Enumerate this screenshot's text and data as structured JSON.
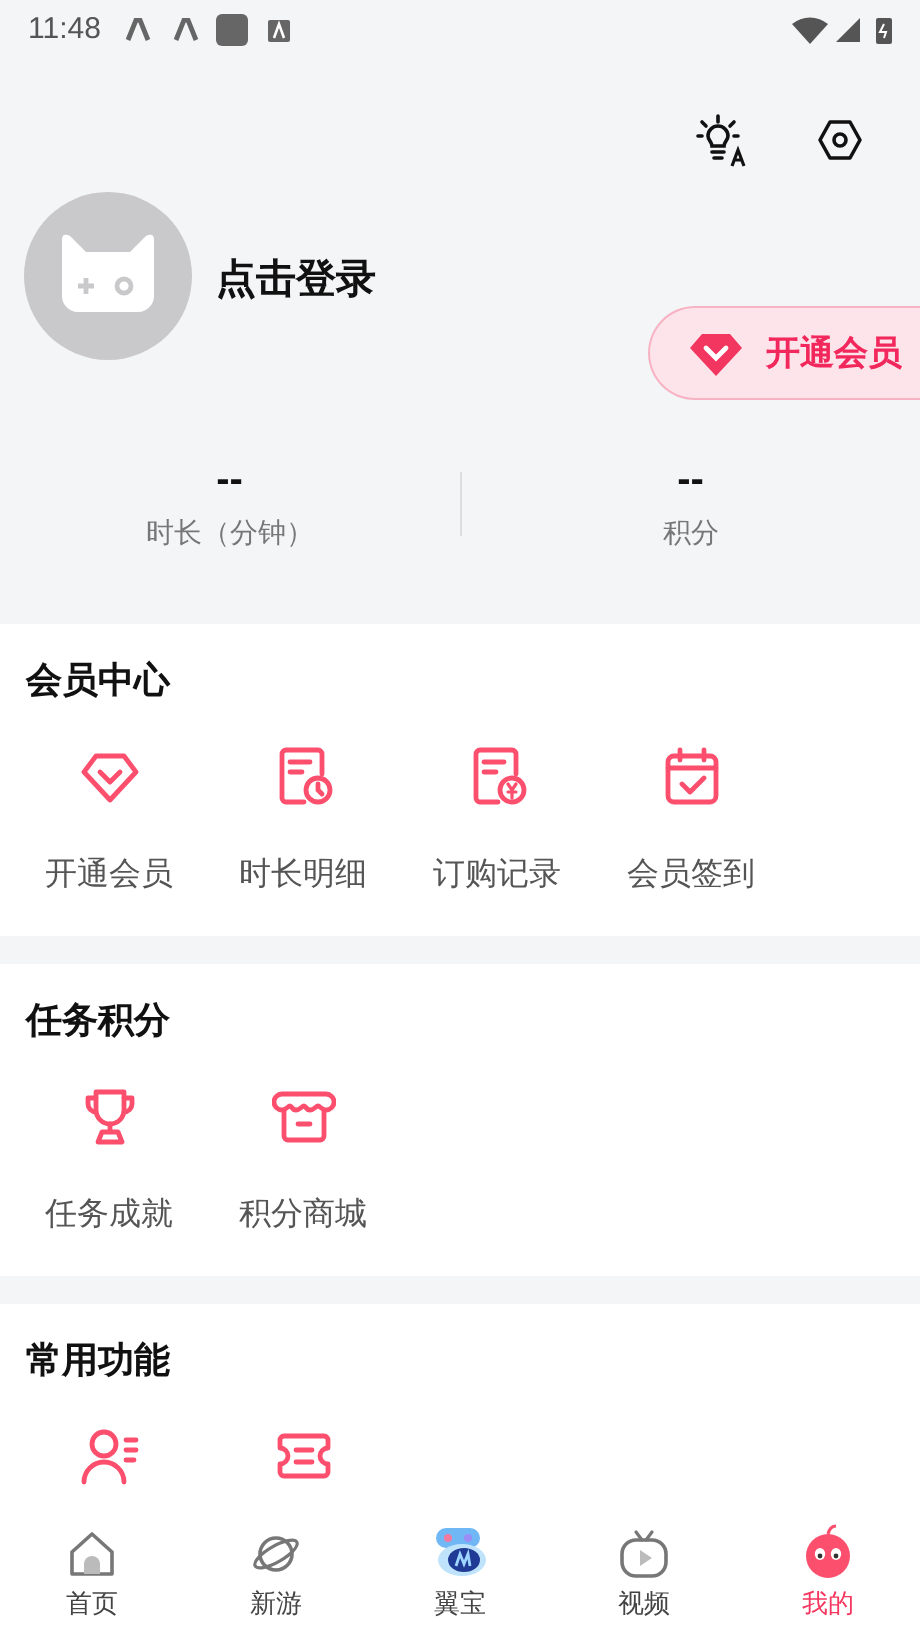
{
  "status_bar": {
    "time": "11:48"
  },
  "profile": {
    "name": "点击登录",
    "vip_button": "开通会员"
  },
  "stats": [
    {
      "value": "--",
      "label": "时长（分钟）"
    },
    {
      "value": "--",
      "label": "积分"
    }
  ],
  "sections": [
    {
      "title": "会员中心",
      "items": [
        {
          "kind": "diamond",
          "label": "开通会员"
        },
        {
          "kind": "bill-clock",
          "label": "时长明细"
        },
        {
          "kind": "bill-yen",
          "label": "订购记录"
        },
        {
          "kind": "calendar",
          "label": "会员签到"
        }
      ]
    },
    {
      "title": "任务积分",
      "items": [
        {
          "kind": "trophy",
          "label": "任务成就"
        },
        {
          "kind": "shop",
          "label": "积分商城"
        }
      ]
    },
    {
      "title": "常用功能",
      "items": [
        {
          "kind": "person"
        },
        {
          "kind": "ticket"
        }
      ]
    }
  ],
  "bottom_nav": [
    {
      "kind": "home",
      "label": "首页",
      "selected": false
    },
    {
      "kind": "planet",
      "label": "新游",
      "selected": false
    },
    {
      "kind": "gamepad",
      "label": "翼宝",
      "selected": false
    },
    {
      "kind": "tv",
      "label": "视频",
      "selected": false
    },
    {
      "kind": "face",
      "label": "我的",
      "selected": true
    }
  ]
}
